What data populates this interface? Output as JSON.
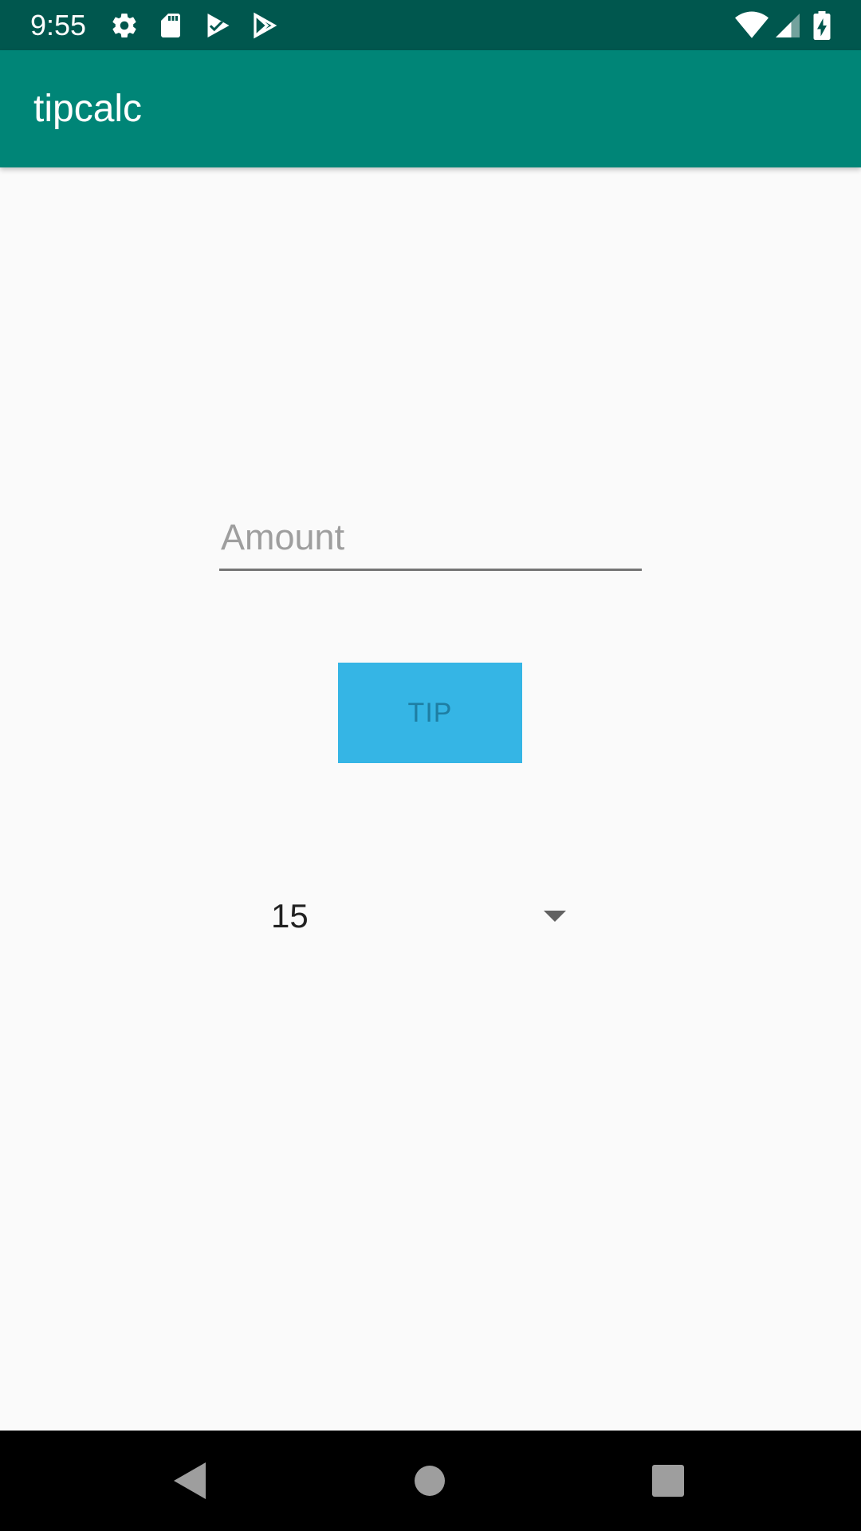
{
  "status_bar": {
    "time": "9:55",
    "left_icons": [
      "gear-icon",
      "sd-card-icon",
      "play-store-check-icon",
      "play-store-icon"
    ],
    "right_icons": [
      "wifi-icon",
      "cellular-signal-icon",
      "battery-charging-icon"
    ],
    "background_color": "#00574e"
  },
  "app_bar": {
    "title": "tipcalc",
    "background_color": "#008577"
  },
  "form": {
    "amount_placeholder": "Amount",
    "amount_value": "",
    "tip_button_label": "TIP",
    "tip_button_color": "#35b5e5",
    "spinner_selected": "15"
  },
  "nav_bar": {
    "icons": [
      "back-icon",
      "home-icon",
      "recents-icon"
    ]
  }
}
